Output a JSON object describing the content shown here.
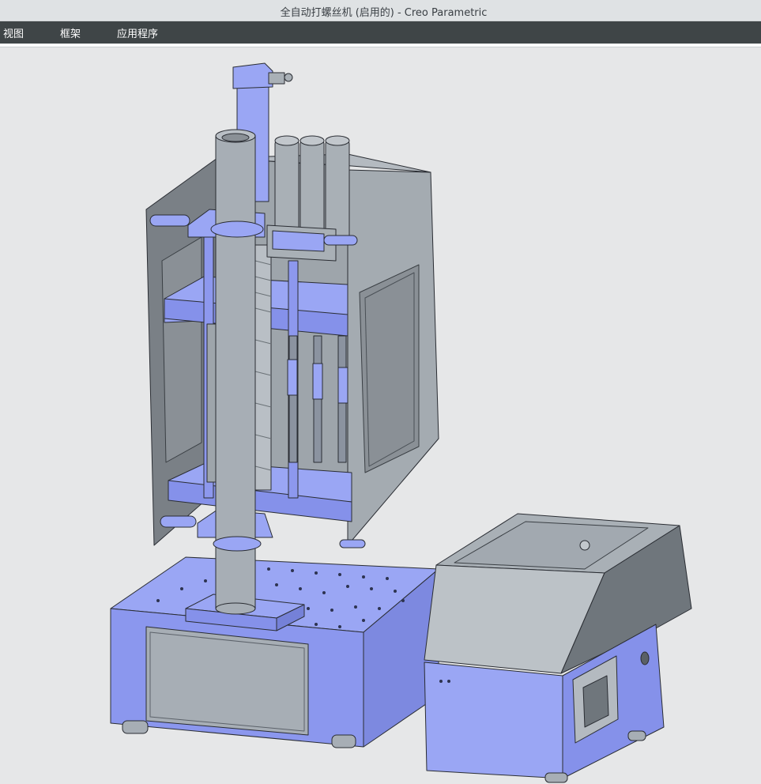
{
  "window": {
    "title": "全自动打螺丝机 (启用的) - Creo Parametric"
  },
  "menu": {
    "items": [
      "视图",
      "框架",
      "应用程序"
    ]
  },
  "colors": {
    "background": "#e6e7e8",
    "menubar": "#3f4547",
    "blue_part": "#9aa6f4",
    "gray_part": "#a9b0b6",
    "dark_gray": "#6b7277",
    "edge": "#2a2d33"
  },
  "icons": [
    "cad-model-icon"
  ]
}
